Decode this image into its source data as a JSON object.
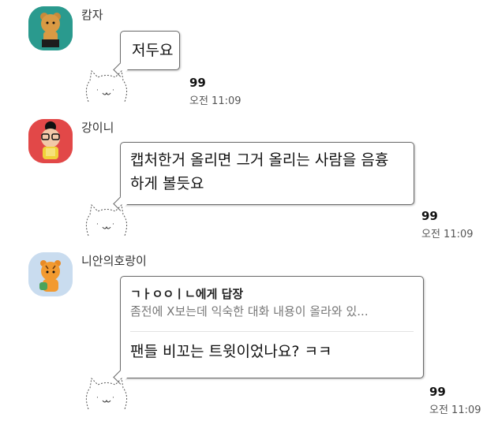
{
  "messages": [
    {
      "sender": "캄자",
      "avatar_icon": "ryan-bear-avatar-icon",
      "text": "저두요",
      "read_count": "99",
      "time": "오전 11:09"
    },
    {
      "sender": "강이니",
      "avatar_icon": "apeach-avatar-icon",
      "text_line1": "캡처한거 올리면 그거 올리는 사람을 음흉",
      "text_line2": "하게 볼듯요",
      "read_count": "99",
      "time": "오전 11:09"
    },
    {
      "sender": "니안의호랑이",
      "avatar_icon": "tiger-avatar-icon",
      "reply_to": "ㄱㅏㅇㅇㅣㄴ에게 답장",
      "reply_preview": "좀전에 X보는데 익숙한 대화 내용이 올라와 있...",
      "text": "팬들 비꼬는 트윗이었나요? ㅋㅋ",
      "read_count": "99",
      "time": "오전 11:09"
    }
  ],
  "colors": {
    "avatar1_bg": "#2a9a8e",
    "avatar2_bg": "#e24848",
    "avatar3_bg": "#c9dcef",
    "bubble_border": "#6a6a6a"
  }
}
